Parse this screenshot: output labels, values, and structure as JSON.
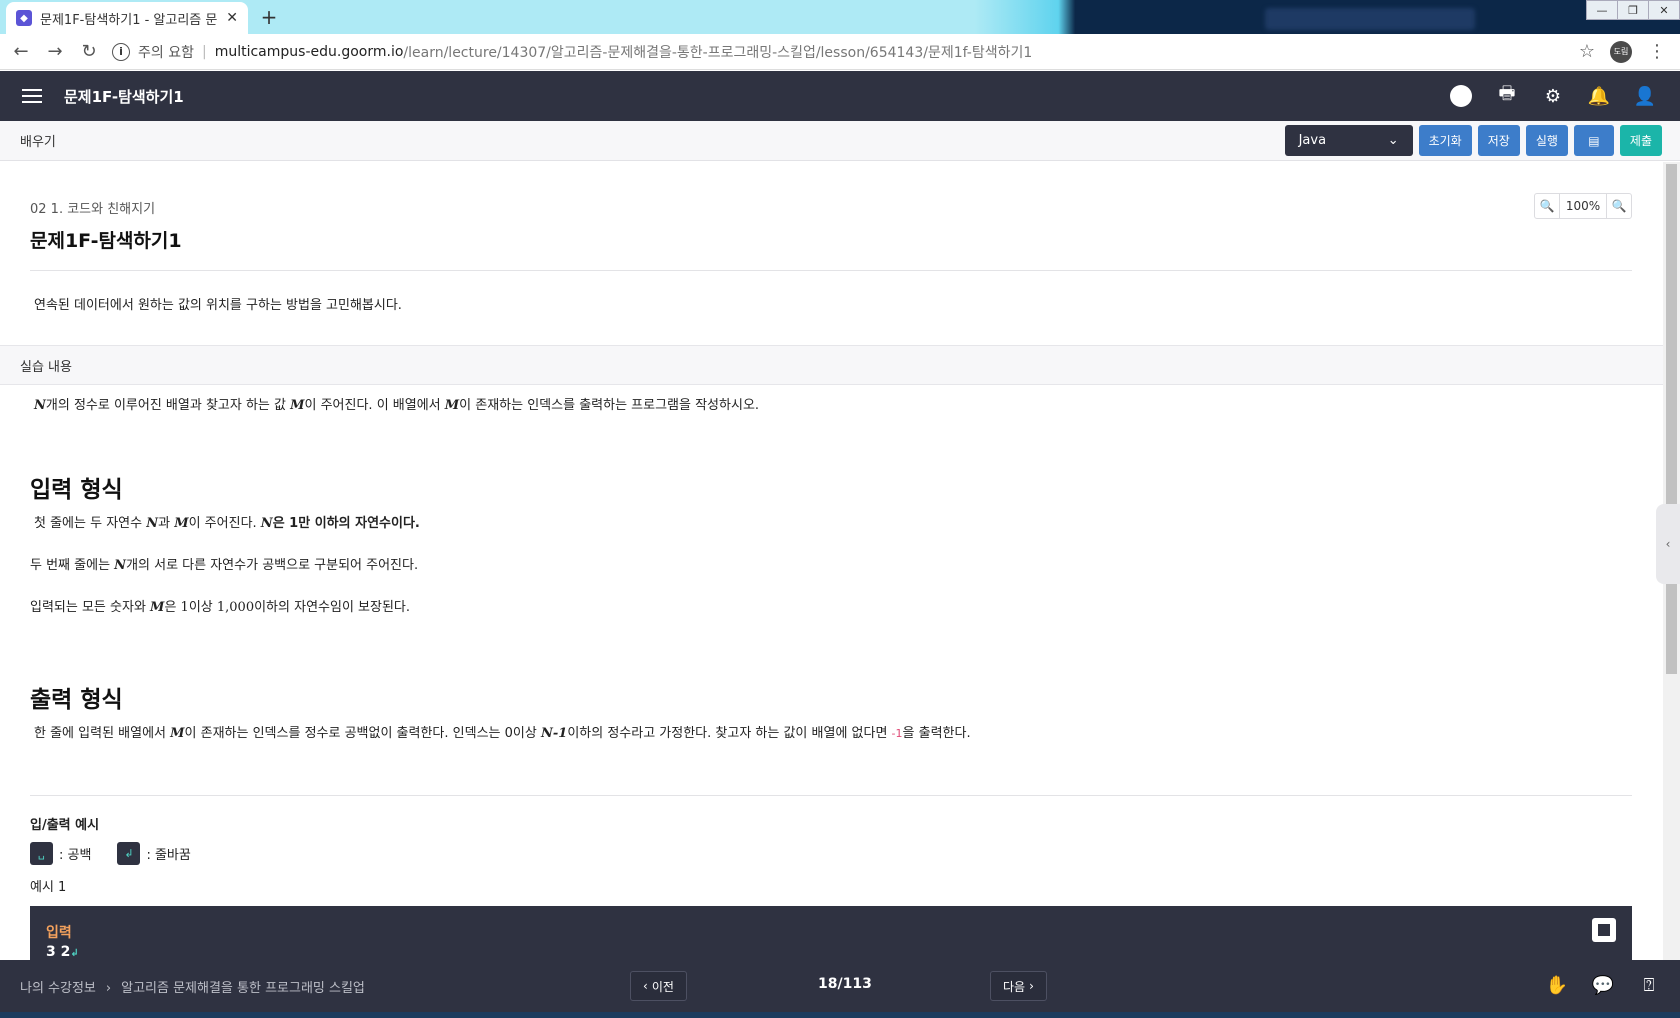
{
  "browser": {
    "tab_title": "문제1F-탐색하기1 - 알고리즘 문",
    "url_warning": "주의 요함",
    "url_host": "multicampus-edu.goorm.io",
    "url_path": "/learn/lecture/14307/알고리즘-문제해결을-통한-프로그래밍-스킬업/lesson/654143/문제1f-탐색하기1",
    "profile_label": "도림"
  },
  "header": {
    "title": "문제1F-탐색하기1"
  },
  "toolbar": {
    "learn_label": "배우기",
    "language": "Java",
    "reset_label": "초기화",
    "save_label": "저장",
    "run_label": "실행",
    "submit_label": "제출"
  },
  "lesson": {
    "breadcrumb": "02 1. 코드와 친해지기",
    "zoom": "100%",
    "title": "문제1F-탐색하기1",
    "description": "연속된 데이터에서 원하는 값의 위치를 구하는 방법을 고민해봅시다.",
    "practice_header": "실습 내용",
    "problem": {
      "N": "N",
      "M": "M",
      "t1": "개의 정수로 이루어진 배열과 찾고자 하는 값 ",
      "t2": "이 주어진다. 이 배열에서 ",
      "t3": "이 존재하는 인덱스를 출력하는 프로그램을 작성하시오."
    },
    "input_heading": "입력 형식",
    "input": {
      "l1a": "첫 줄에는 두 자연수 ",
      "l1b": "과 ",
      "l1c": "이 주어진다. ",
      "l1d": "은 1만 이하의 자연수이다.",
      "l2a": "두 번째 줄에는 ",
      "l2b": "개의 서로 다른 자연수가 공백으로 구분되어 주어진다.",
      "l3a": "입력되는 모든 숫자와 ",
      "l3b": "은 ",
      "l3c": "1",
      "l3d": "이상 ",
      "l3e": "1,000",
      "l3f": "이하의 자연수임이 보장된다."
    },
    "output_heading": "출력 형식",
    "output": {
      "a": "한 줄에 입력된 배열에서 ",
      "b": "이 존재하는 인덱스를 정수로 공백없이 출력한다. 인덱스는 ",
      "c": "0",
      "d": "이상 ",
      "e": "N-1",
      "f": "이하의 정수라고 가정한다. 찾고자 하는 값이 배열에 없다면 ",
      "g": "-1",
      "h": "을 출력한다."
    },
    "io_example_label": "입/출력 예시",
    "legend_space": ": 공백",
    "legend_newline": ": 줄바꿈",
    "example_label": "예시 1",
    "example_input_label": "입력",
    "example_input_value": "3 2"
  },
  "footer": {
    "crumb1": "나의 수강정보",
    "crumb2": "알고리즘 문제해결을 통한 프로그래밍 스킬업",
    "prev_label": "이전",
    "page": "18/113",
    "next_label": "다음"
  }
}
